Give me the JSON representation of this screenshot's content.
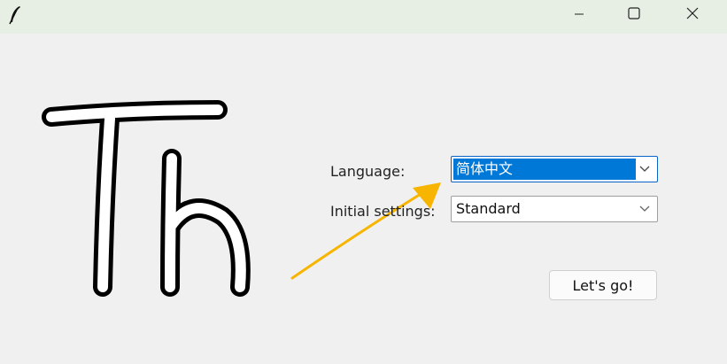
{
  "window": {
    "app_icon": "feather-icon",
    "controls": {
      "minimize_icon": "minimize-icon",
      "maximize_icon": "maximize-icon",
      "close_icon": "close-icon"
    },
    "titlebar_color": "#e7efe5"
  },
  "logo": {
    "text": "Th"
  },
  "form": {
    "language_label": "Language:",
    "language_value": "简体中文",
    "initial_settings_label": "Initial settings:",
    "initial_settings_value": "Standard",
    "dropdown_icon": "chevron-down-icon"
  },
  "actions": {
    "go_label": "Let's go!"
  },
  "colors": {
    "selection": "#0078d7",
    "arrow": "#f7b500",
    "background": "#f0f0f0"
  },
  "annotation": {
    "arrow_icon": "arrow-icon"
  }
}
